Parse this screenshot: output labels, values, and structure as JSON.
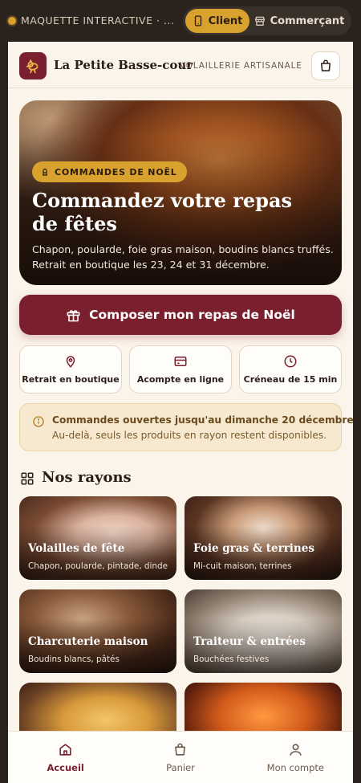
{
  "demo_bar": {
    "label": "MAQUETTE INTERACTIVE · ...",
    "roles": [
      {
        "label": "Client",
        "icon": "phone-icon",
        "active": true
      },
      {
        "label": "Commerçant",
        "icon": "store-icon",
        "active": false
      }
    ]
  },
  "header": {
    "brand": "La Petite Basse-cour",
    "tagline": "VOLAILLERIE ARTISANALE",
    "logo_icon": "rooster-icon",
    "cart_icon": "shopping-bag-icon"
  },
  "hero": {
    "badge": "COMMANDES DE NOËL",
    "title": "Commandez votre repas de fêtes",
    "description": "Chapon, poularde, foie gras maison, boudins blancs truffés. Retrait en boutique les 23, 24 et 31 décembre."
  },
  "cta": {
    "label": "Composer mon repas de Noël",
    "icon": "gift-icon"
  },
  "features": [
    {
      "label": "Retrait en boutique",
      "icon": "map-pin-icon"
    },
    {
      "label": "Acompte en ligne",
      "icon": "credit-card-icon"
    },
    {
      "label": "Créneau de 15 min",
      "icon": "clock-icon"
    }
  ],
  "notice": {
    "title": "Commandes ouvertes jusqu'au dimanche 20 décembre.",
    "text": "Au-delà, seuls les produits en rayon restent disponibles."
  },
  "section": {
    "title": "Nos rayons",
    "icon": "grid-icon"
  },
  "categories": [
    {
      "title": "Volailles de fête",
      "subtitle": "Chapon, poularde, pintade, dinde"
    },
    {
      "title": "Foie gras & terrines",
      "subtitle": "Mi-cuit maison, terrines"
    },
    {
      "title": "Charcuterie maison",
      "subtitle": "Boudins blancs, pâtés"
    },
    {
      "title": "Traiteur & entrées",
      "subtitle": "Bouchées festives"
    },
    {
      "title": "",
      "subtitle": ""
    },
    {
      "title": "",
      "subtitle": ""
    }
  ],
  "nav": [
    {
      "label": "Accueil",
      "icon": "home-icon",
      "active": true
    },
    {
      "label": "Panier",
      "icon": "bag-icon",
      "active": false
    },
    {
      "label": "Mon compte",
      "icon": "user-icon",
      "active": false
    }
  ],
  "colors": {
    "primary": "#7a1f2e",
    "accent": "#d9a22e",
    "background": "#fbf4ea"
  }
}
